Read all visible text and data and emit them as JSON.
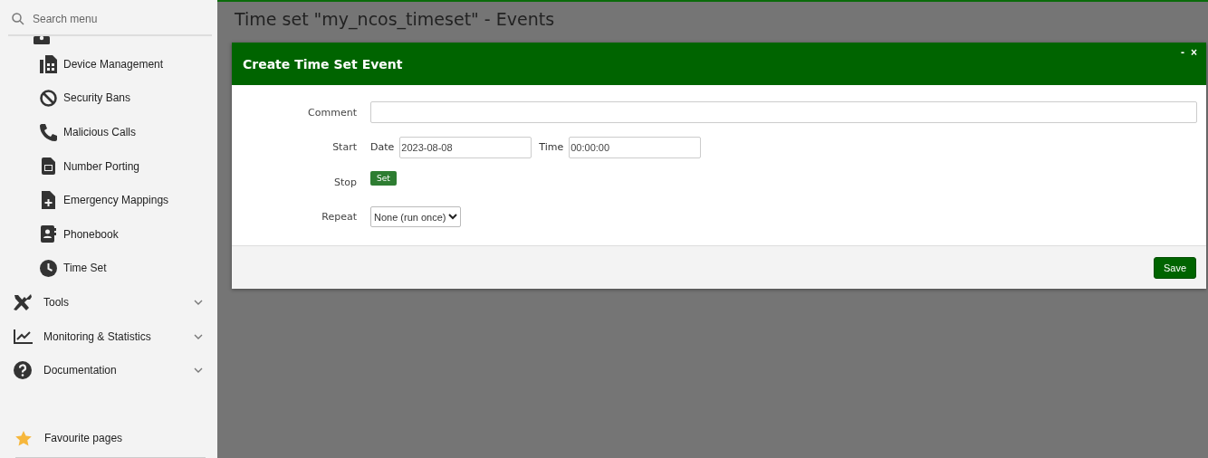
{
  "sidebar": {
    "search": {
      "placeholder": "Search menu"
    },
    "items": [
      {
        "label": "Device Management",
        "kind": "sub"
      },
      {
        "label": "Security Bans",
        "kind": "sub"
      },
      {
        "label": "Malicious Calls",
        "kind": "sub"
      },
      {
        "label": "Number Porting",
        "kind": "sub"
      },
      {
        "label": "Emergency Mappings",
        "kind": "sub"
      },
      {
        "label": "Phonebook",
        "kind": "sub"
      },
      {
        "label": "Time Set",
        "kind": "sub"
      },
      {
        "label": "Tools",
        "kind": "group",
        "expanded": false
      },
      {
        "label": "Monitoring & Statistics",
        "kind": "group",
        "expanded": false
      },
      {
        "label": "Documentation",
        "kind": "group",
        "expanded": false
      }
    ],
    "favourites": "Favourite pages"
  },
  "page": {
    "title": "Time set \"my_ncos_timeset\" - Events"
  },
  "dialog": {
    "title": "Create Time Set Event",
    "minimize": "-",
    "close": "×",
    "comment": {
      "label": "Comment"
    },
    "start": {
      "label": "Start",
      "date_label": "Date",
      "date_value": "2023-08-08",
      "time_label": "Time",
      "time_value": "00:00:00"
    },
    "stop": {
      "label": "Stop",
      "button": "Set"
    },
    "repeat": {
      "label": "Repeat",
      "value": "None (run once)"
    },
    "save": "Save"
  }
}
